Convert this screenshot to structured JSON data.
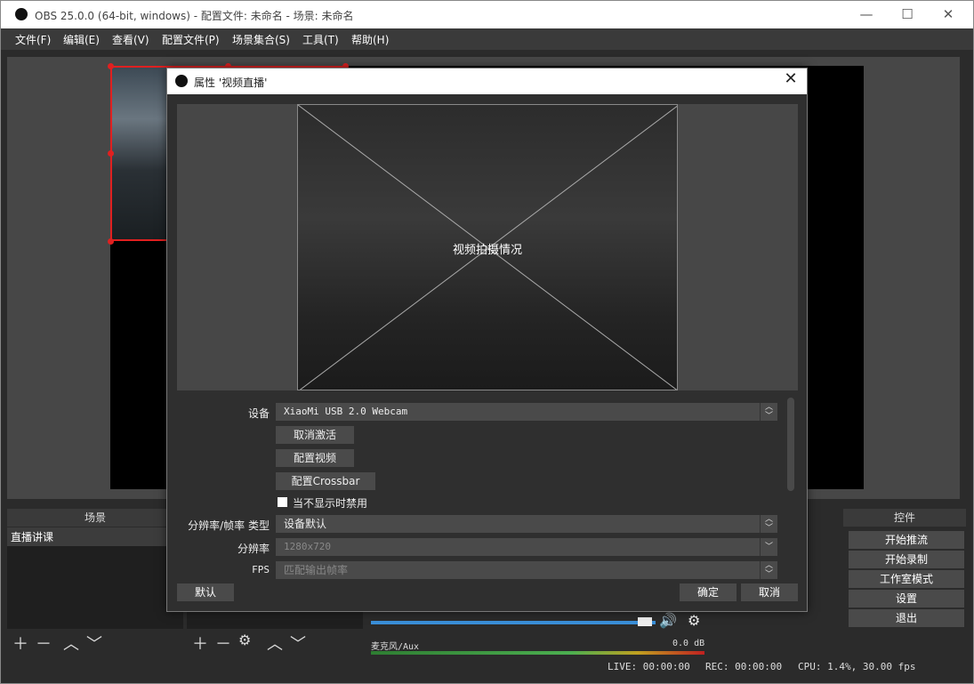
{
  "window": {
    "title": "OBS 25.0.0 (64-bit, windows) - 配置文件: 未命名 - 场景: 未命名",
    "minimize": "—",
    "maximize": "☐",
    "close": "✕"
  },
  "menu": [
    "文件(F)",
    "编辑(E)",
    "查看(V)",
    "配置文件(P)",
    "场景集合(S)",
    "工具(T)",
    "帮助(H)"
  ],
  "docks": {
    "scenes": {
      "title": "场景",
      "items": [
        "直播讲课"
      ]
    },
    "controls": {
      "title": "控件",
      "buttons": [
        "开始推流",
        "开始录制",
        "工作室模式",
        "设置",
        "退出"
      ]
    },
    "mixer": {
      "source_name": "麦克风/Aux",
      "level": "0.0 dB"
    }
  },
  "status": {
    "live": "LIVE: 00:00:00",
    "rec": "REC: 00:00:00",
    "cpu": "CPU: 1.4%, 30.00 fps"
  },
  "dialog": {
    "title": "属性 '视频直播'",
    "close": "✕",
    "preview_label": "视频拍摄情况",
    "device_label": "设备",
    "device_value": "XiaoMi USB 2.0 Webcam",
    "deactivate_button": "取消激活",
    "configure_video_button": "配置视频",
    "configure_crossbar_button": "配置Crossbar",
    "hide_disable_label": "当不显示时禁用",
    "res_type_label": "分辨率/帧率 类型",
    "res_type_value": "设备默认",
    "resolution_label": "分辨率",
    "resolution_value": "1280x720",
    "fps_label": "FPS",
    "fps_value": "匹配输出帧率",
    "defaults_button": "默认",
    "ok_button": "确定",
    "cancel_button": "取消"
  },
  "colors": {
    "accent_red": "#e02020",
    "dark_bg": "#2b2b2b",
    "button": "#4a4a4a"
  }
}
